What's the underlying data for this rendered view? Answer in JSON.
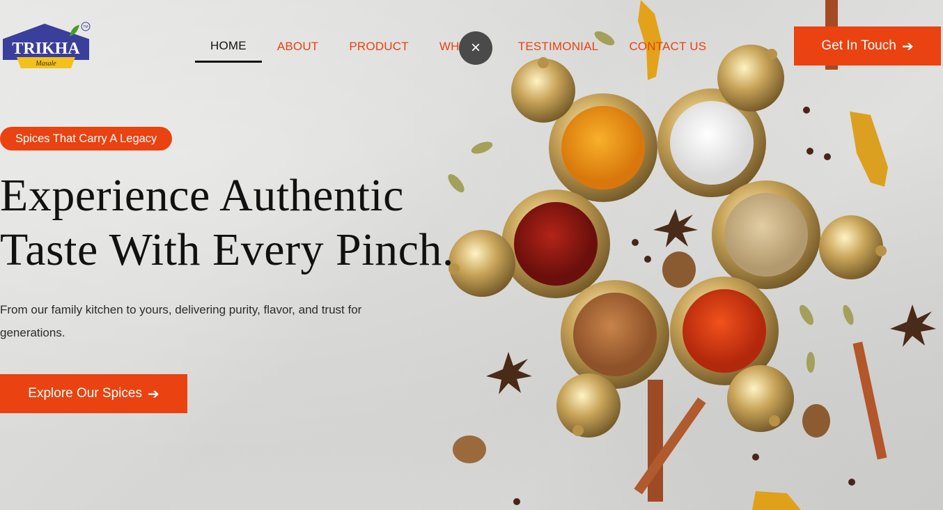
{
  "brand": {
    "logo_text": "TRIKHA",
    "logo_sub": "Masale",
    "tm": "TM"
  },
  "nav": {
    "items": [
      {
        "label": "HOME",
        "active": true
      },
      {
        "label": "ABOUT"
      },
      {
        "label": "PRODUCT"
      },
      {
        "label": "WHY US"
      },
      {
        "label": "TESTIMONIAL"
      },
      {
        "label": "CONTACT US"
      }
    ]
  },
  "close_icon": "×",
  "header_cta": {
    "label": "Get In Touch",
    "icon": "arrow-right-icon",
    "arrow": "➔"
  },
  "hero": {
    "badge": "Spices That Carry A Legacy",
    "headline_line1": "Experience Authentic",
    "headline_line2": "Taste With Every Pinch.",
    "subtext": "From our family kitchen to yours, delivering purity, flavor, and trust for generations.",
    "cta": {
      "label": "Explore Our Spices",
      "arrow": "➔"
    }
  },
  "colors": {
    "accent": "#ea4210",
    "brand_blue": "#3a3f9b",
    "text_dark": "#111111"
  }
}
